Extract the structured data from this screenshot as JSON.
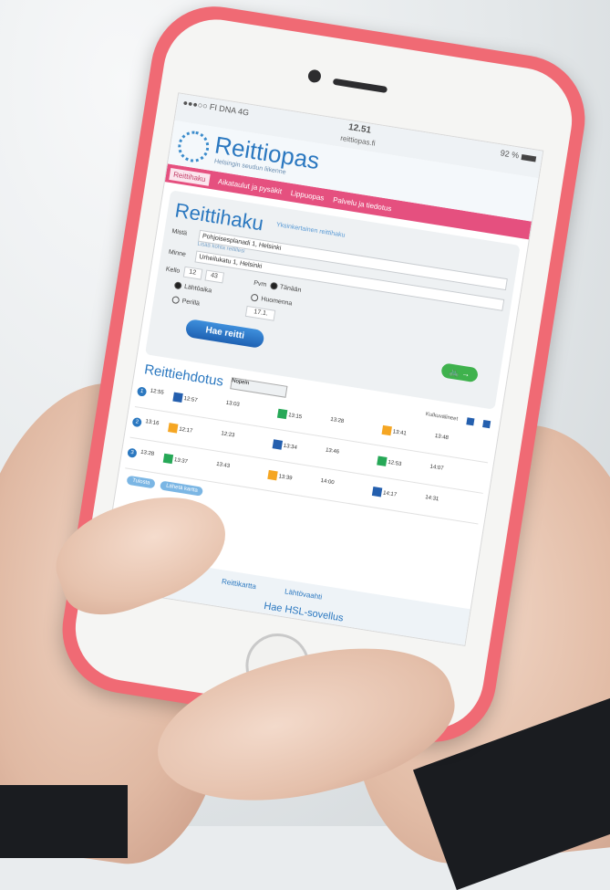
{
  "status_bar": {
    "carrier": "●●●○○ FI DNA  4G",
    "time": "12.51",
    "url": "reittiopas.fi",
    "battery": "92 %"
  },
  "header": {
    "title": "Reittiopas",
    "subtitle": "Helsingin seudun liikenne"
  },
  "nav": {
    "items": [
      "Reittihaku",
      "Aikataulut ja pysäkit",
      "Lippuopas",
      "Palvelu ja tiedotus"
    ]
  },
  "search": {
    "heading": "Reittihaku",
    "help_link": "Yksinkertainen reittihaku",
    "from_label": "Mistä",
    "from_value": "Pohjoisesplanadi 1, Helsinki",
    "from_hint": "Lisää kohta reitillesi",
    "to_label": "Minne",
    "to_value": "Urheilukatu 1, Helsinki",
    "time_label": "Kello",
    "hour": "12",
    "minute": "43",
    "option1": "Lähtöaika",
    "option2": "Perillä",
    "date_label": "Pvm",
    "radio_today": "Tänään",
    "radio_tomorrow": "Huomenna",
    "date_value": "17.1.",
    "search_button": "Hae reitti",
    "bike_button": "🚲 →"
  },
  "results": {
    "title": "Reittiehdotus",
    "sort_value": "Nopein",
    "transport_label": "Kulkuvälineet",
    "routes": [
      {
        "idx": "1",
        "depart": "12:55",
        "times": [
          "12:57",
          "13:03",
          "13:15",
          "13:28",
          "13:41",
          "13:48"
        ]
      },
      {
        "idx": "2",
        "depart": "13:16",
        "times": [
          "12:17",
          "12:23",
          "13:34",
          "13:46",
          "12:53",
          "14:07"
        ]
      },
      {
        "idx": "3",
        "depart": "13:28",
        "times": [
          "13:37",
          "13:43",
          "13:39",
          "14:00",
          "14:17",
          "14:31"
        ]
      }
    ],
    "tags": [
      "Tulosta",
      "Lähetä kartta"
    ]
  },
  "footer": {
    "link1": "Reittikartta",
    "link2": "Lähtövaahti",
    "promo": "Hae HSL-sovellus"
  }
}
